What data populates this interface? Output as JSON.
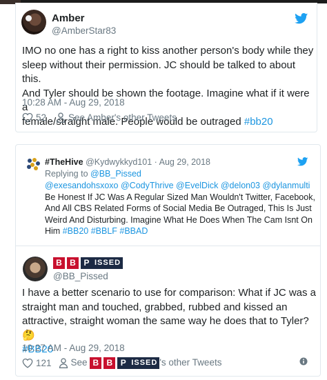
{
  "tweet1": {
    "name": "Amber",
    "handle": "@AmberStar83",
    "text_lines": [
      "IMO no one has a right to kiss another person's body while they",
      "sleep without their permission. JC should be talked to about this.",
      "And Tyler should be shown the footage. Imagine what if it were a",
      "female/straight male. People would be outraged "
    ],
    "hashtag": "#bb20",
    "timestamp": "10:28 AM - Aug 29, 2018",
    "like_count": "52",
    "see_others": "See Amber's other Tweets"
  },
  "quoted": {
    "name": "#TheHive",
    "handle": "@Kydwykkyd101",
    "separator": "·",
    "date": "Aug 29, 2018",
    "replying_to_label": "Replying to ",
    "replying_to_handle": "@BB_Pissed",
    "mentions": "@exesandohsxoxo @CodyThrive @EvelDick @delon03 @dylanmulti",
    "text_lines": [
      "Be Honest If JC Was A Regular Sized Man Wouldn't Twitter, Facebook,",
      "And All CBS Related Forms of Social Media Be Outraged, This Is Just",
      "Weird And Disturbing. Imagine What He Does When The Cam Isnt On",
      "Him "
    ],
    "hashtags": "#BB20 #BBLF #BBAD"
  },
  "tweet2": {
    "name_b1": "B",
    "name_b2": "B",
    "name_p": "P",
    "name_rest": "ISSED",
    "handle": "@BB_Pissed",
    "text_lines": [
      "I have a better scenario to use for comparison: What if JC was a",
      "straight man and touched, grabbed, rubbed and kissed an",
      "attractive, straight woman the same way he does that to Tyler?🤔"
    ],
    "hashtag": "#BB20",
    "timestamp": "10:27 AM - Aug 29, 2018",
    "like_count": "121",
    "see_prefix": "See ",
    "see_suffix": "'s other Tweets"
  },
  "colors": {
    "link": "#1b95e0",
    "meta": "#697882",
    "border": "#e1e8ed",
    "bb_red": "#c8102e",
    "bb_navy": "#1c2a44"
  },
  "icons": {
    "bird": "twitter-bird-icon",
    "heart": "heart-icon",
    "person": "person-icon",
    "info": "info-icon"
  }
}
